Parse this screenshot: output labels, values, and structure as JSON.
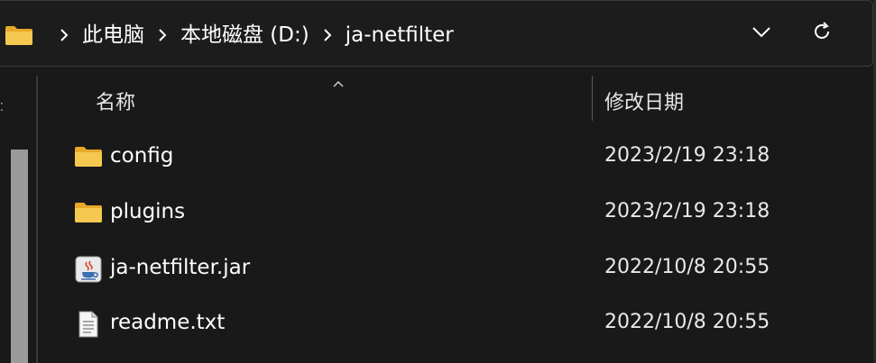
{
  "breadcrumb": {
    "items": [
      "此电脑",
      "本地磁盘 (D:)",
      "ja-netfilter"
    ]
  },
  "controls": {
    "dropdown_icon": "chevron-down-icon",
    "refresh_icon": "refresh-icon"
  },
  "columns": {
    "name": "名称",
    "date_modified": "修改日期"
  },
  "files": [
    {
      "name": "config",
      "date": "2023/2/19 23:18",
      "icon": "folder-icon"
    },
    {
      "name": "plugins",
      "date": "2023/2/19 23:18",
      "icon": "folder-icon"
    },
    {
      "name": "ja-netfilter.jar",
      "date": "2022/10/8 20:55",
      "icon": "java-jar-icon"
    },
    {
      "name": "readme.txt",
      "date": "2022/10/8 20:55",
      "icon": "text-file-icon"
    }
  ],
  "colors": {
    "background": "#191919",
    "folder": "#f3c24d",
    "text": "#ffffff"
  }
}
